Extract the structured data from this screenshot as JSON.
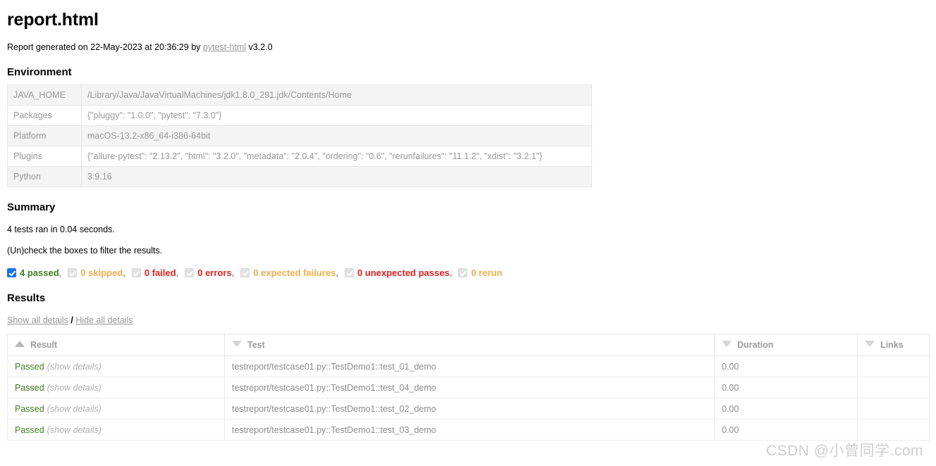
{
  "report": {
    "title": "report.html",
    "generated_prefix": "Report generated on ",
    "date": "22-May-2023",
    "at_text": " at ",
    "time": "20:36:29",
    "by_text": " by ",
    "tool_link": "pytest-html",
    "version": " v3.2.0"
  },
  "environment": {
    "heading": "Environment",
    "rows": [
      {
        "key": "JAVA_HOME",
        "value": "/Library/Java/JavaVirtualMachines/jdk1.8.0_291.jdk/Contents/Home"
      },
      {
        "key": "Packages",
        "value": "{\"pluggy\": \"1.0.0\", \"pytest\": \"7.3.0\"}"
      },
      {
        "key": "Platform",
        "value": "macOS-13.2-x86_64-i386-64bit"
      },
      {
        "key": "Plugins",
        "value": "{\"allure-pytest\": \"2.13.2\", \"html\": \"3.2.0\", \"metadata\": \"2.0.4\", \"ordering\": \"0.6\", \"rerunfailures\": \"11.1.2\", \"xdist\": \"3.2.1\"}"
      },
      {
        "key": "Python",
        "value": "3.9.16"
      }
    ]
  },
  "summary": {
    "heading": "Summary",
    "run_line": "4 tests ran in 0.04 seconds.",
    "filter_hint": "(Un)check the boxes to filter the results.",
    "filters": [
      {
        "label": "4 passed",
        "checked": true,
        "color": "#3f7d20",
        "trailing": ","
      },
      {
        "label": "0 skipped",
        "checked": true,
        "color": "#f0ad4e",
        "trailing": ","
      },
      {
        "label": "0 failed",
        "checked": true,
        "color": "#e02020",
        "trailing": ","
      },
      {
        "label": "0 errors",
        "checked": true,
        "color": "#e02020",
        "trailing": ","
      },
      {
        "label": "0 expected failures",
        "checked": true,
        "color": "#f0ad4e",
        "trailing": ","
      },
      {
        "label": "0 unexpected passes",
        "checked": true,
        "color": "#e02020",
        "trailing": ","
      },
      {
        "label": "0 rerun",
        "checked": true,
        "color": "#f0ad4e",
        "trailing": ""
      }
    ]
  },
  "results": {
    "heading": "Results",
    "show_all": "Show all details",
    "separator": "/",
    "hide_all": "Hide all details",
    "columns": [
      {
        "label": "Result",
        "sort": "asc"
      },
      {
        "label": "Test",
        "sort": "desc"
      },
      {
        "label": "Duration",
        "sort": "desc"
      },
      {
        "label": "Links",
        "sort": "desc"
      }
    ],
    "show_details_label": "(show details)",
    "rows": [
      {
        "result": "Passed",
        "test": "testreport/testcase01.py::TestDemo1::test_01_demo",
        "duration": "0.00",
        "links": ""
      },
      {
        "result": "Passed",
        "test": "testreport/testcase01.py::TestDemo1::test_04_demo",
        "duration": "0.00",
        "links": ""
      },
      {
        "result": "Passed",
        "test": "testreport/testcase01.py::TestDemo1::test_02_demo",
        "duration": "0.00",
        "links": ""
      },
      {
        "result": "Passed",
        "test": "testreport/testcase01.py::TestDemo1::test_03_demo",
        "duration": "0.00",
        "links": ""
      }
    ]
  },
  "watermark": {
    "text": "CSDN @小曾同学.com"
  }
}
